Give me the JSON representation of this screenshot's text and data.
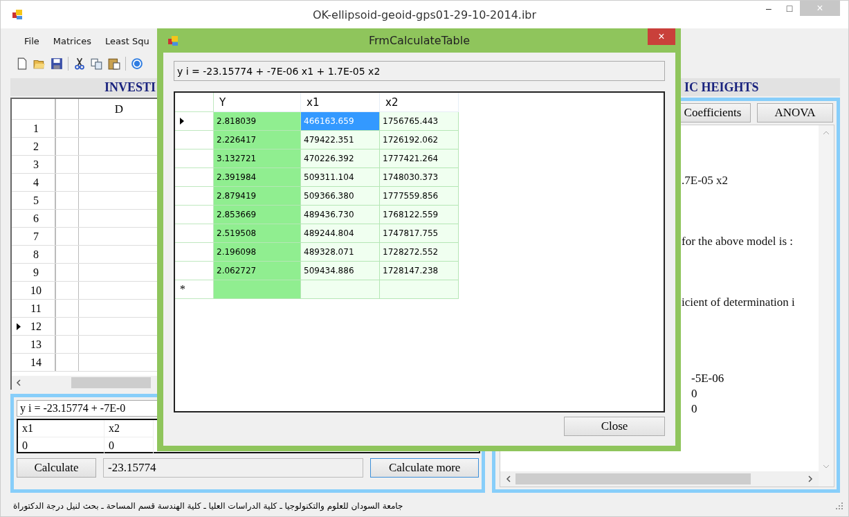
{
  "window": {
    "title": "OK-ellipsoid-geoid-gps01-29-10-2014.ibr",
    "controls": [
      "–",
      "□",
      "×"
    ]
  },
  "menu": [
    "File",
    "Matrices",
    "Least Squ"
  ],
  "toolbar": [
    {
      "kind": "new"
    },
    {
      "kind": "open"
    },
    {
      "kind": "save"
    },
    {
      "kind": "sep"
    },
    {
      "kind": "cut"
    },
    {
      "kind": "copy"
    },
    {
      "kind": "paste"
    },
    {
      "kind": "sep"
    },
    {
      "kind": "help"
    }
  ],
  "header_left": "INVESTI",
  "header_right": "IC HEIGHTS",
  "grid": {
    "column": "D",
    "rows": [
      {
        "number": "1",
        "current": false
      },
      {
        "number": "2",
        "current": false
      },
      {
        "number": "3",
        "current": false
      },
      {
        "number": "4",
        "current": false
      },
      {
        "number": "5",
        "current": false
      },
      {
        "number": "6",
        "current": false
      },
      {
        "number": "7",
        "current": false
      },
      {
        "number": "8",
        "current": false
      },
      {
        "number": "9",
        "current": false
      },
      {
        "number": "10",
        "current": false
      },
      {
        "number": "11",
        "current": false
      },
      {
        "number": "12",
        "current": true
      },
      {
        "number": "13",
        "current": false
      },
      {
        "number": "14",
        "current": false
      }
    ]
  },
  "equation_field": "y i = -23.15774 + -7E-0",
  "coef_table": {
    "columns": [
      "x1",
      "x2"
    ],
    "values": [
      "0",
      "0"
    ]
  },
  "calculate_button": "Calculate",
  "result_field": "-23.15774",
  "calculate_more_button": "Calculate more",
  "right_panel": {
    "buttons": [
      "Coefficients",
      "ANOVA"
    ],
    "lines": [
      {
        "kind": "text",
        "text": ".7E-05 x2"
      },
      {
        "kind": "text",
        "text": "for the above model is :"
      },
      {
        "kind": "text",
        "text": "icient of determination  i"
      }
    ],
    "values": [
      "-5E-06",
      "0",
      "0"
    ]
  },
  "status_bar": "جامعة السودان للعلوم والتكنولوجيا ـ كلية الدراسات العليا ـ  كلية الهندسة قسم المساحة ـ بحث لنيل درجة الدكتوراة",
  "dialog": {
    "title": "FrmCalculateTable",
    "close_glyph": "×",
    "equation": "y i = -23.15774 + -7E-06 x1 + 1.7E-05 x2",
    "columns": [
      "Y",
      "x1",
      "x2"
    ],
    "rows": [
      {
        "current": true,
        "cells": [
          {
            "text": "2.818039",
            "selected": false
          },
          {
            "text": "466163.659",
            "selected": true
          },
          {
            "text": "1756765.443",
            "selected": false
          }
        ]
      },
      {
        "current": false,
        "cells": [
          {
            "text": "2.226417",
            "selected": false
          },
          {
            "text": "479422.351",
            "selected": false
          },
          {
            "text": "1726192.062",
            "selected": false
          }
        ]
      },
      {
        "current": false,
        "cells": [
          {
            "text": "3.132721",
            "selected": false
          },
          {
            "text": "470226.392",
            "selected": false
          },
          {
            "text": "1777421.264",
            "selected": false
          }
        ]
      },
      {
        "current": false,
        "cells": [
          {
            "text": "2.391984",
            "selected": false
          },
          {
            "text": "509311.104",
            "selected": false
          },
          {
            "text": "1748030.373",
            "selected": false
          }
        ]
      },
      {
        "current": false,
        "cells": [
          {
            "text": "2.879419",
            "selected": false
          },
          {
            "text": "509366.380",
            "selected": false
          },
          {
            "text": "1777559.856",
            "selected": false
          }
        ]
      },
      {
        "current": false,
        "cells": [
          {
            "text": "2.853669",
            "selected": false
          },
          {
            "text": "489436.730",
            "selected": false
          },
          {
            "text": "1768122.559",
            "selected": false
          }
        ]
      },
      {
        "current": false,
        "cells": [
          {
            "text": "2.519508",
            "selected": false
          },
          {
            "text": "489244.804",
            "selected": false
          },
          {
            "text": "1747817.755",
            "selected": false
          }
        ]
      },
      {
        "current": false,
        "cells": [
          {
            "text": "2.196098",
            "selected": false
          },
          {
            "text": "489328.071",
            "selected": false
          },
          {
            "text": "1728272.552",
            "selected": false
          }
        ]
      },
      {
        "current": false,
        "cells": [
          {
            "text": "2.062727",
            "selected": false
          },
          {
            "text": "509434.886",
            "selected": false
          },
          {
            "text": "1728147.238",
            "selected": false
          }
        ]
      }
    ],
    "new_row_marker": "*",
    "close_button": "Close"
  }
}
